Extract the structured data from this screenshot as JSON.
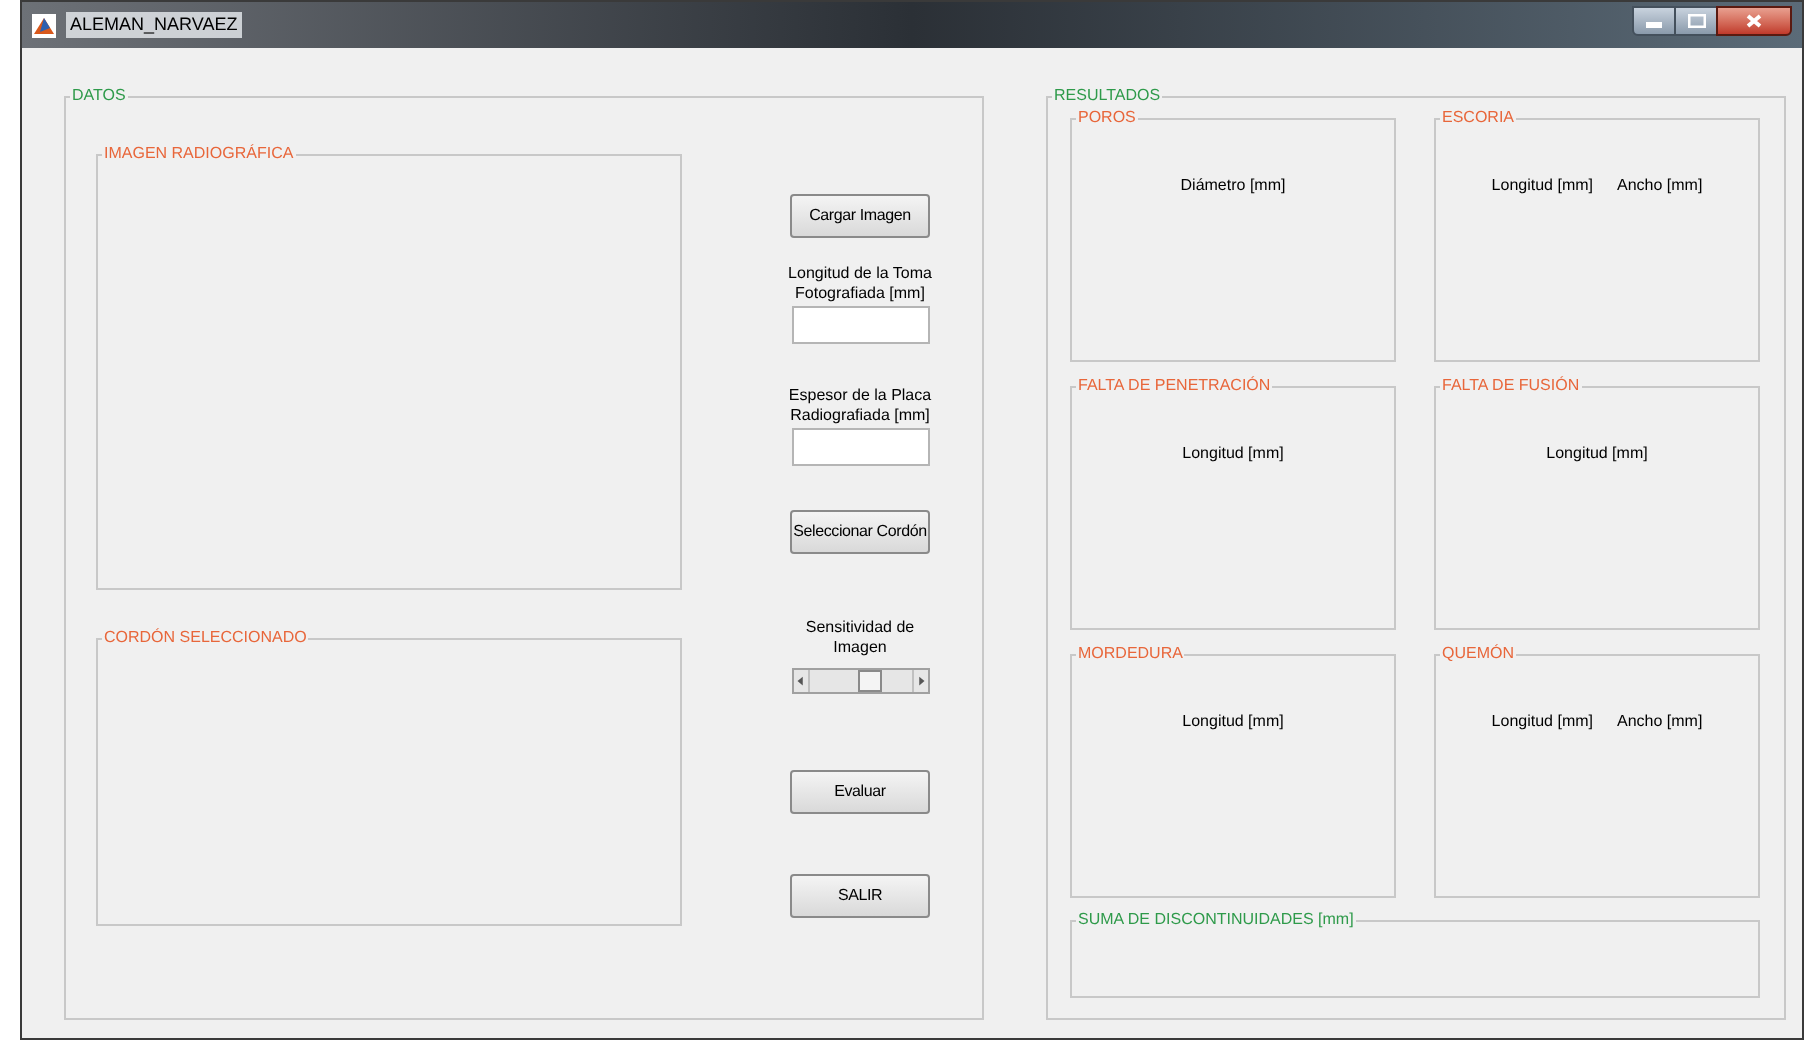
{
  "window": {
    "title": "ALEMAN_NARVAEZ"
  },
  "datos": {
    "title": "DATOS",
    "image_panels": [
      {
        "title": "IMAGEN RADIOGRÁFICA"
      },
      {
        "title": "CORDÓN SELECCIONADO"
      }
    ],
    "controls": [
      {
        "kind": "button",
        "label": "Cargar Imagen"
      },
      {
        "kind": "field",
        "label": "Longitud de la Toma Fotografiada [mm]"
      },
      {
        "kind": "field",
        "label": "Espesor de la Placa Radiografiada [mm]"
      },
      {
        "kind": "button",
        "label": "Seleccionar Cordón"
      },
      {
        "kind": "slider",
        "label": "Sensitividad de Imagen",
        "level": 0.62
      },
      {
        "kind": "button",
        "label": "Evaluar"
      },
      {
        "kind": "button",
        "label": "SALIR"
      }
    ]
  },
  "resultados": {
    "title": "RESULTADOS",
    "panels": [
      {
        "title": "POROS",
        "columns": [
          "Diámetro [mm]"
        ]
      },
      {
        "title": "ESCORIA",
        "columns": [
          "Longitud [mm]",
          "Ancho [mm]"
        ]
      },
      {
        "title": "FALTA DE PENETRACIÓN",
        "columns": [
          "Longitud [mm]"
        ]
      },
      {
        "title": "FALTA DE FUSIÓN",
        "columns": [
          "Longitud [mm]"
        ]
      },
      {
        "title": "MORDEDURA",
        "columns": [
          "Longitud [mm]"
        ]
      },
      {
        "title": "QUEMÓN",
        "columns": [
          "Longitud [mm]",
          "Ancho [mm]"
        ]
      }
    ],
    "summary": {
      "title": "SUMA DE DISCONTINUIDADES [mm]"
    }
  }
}
